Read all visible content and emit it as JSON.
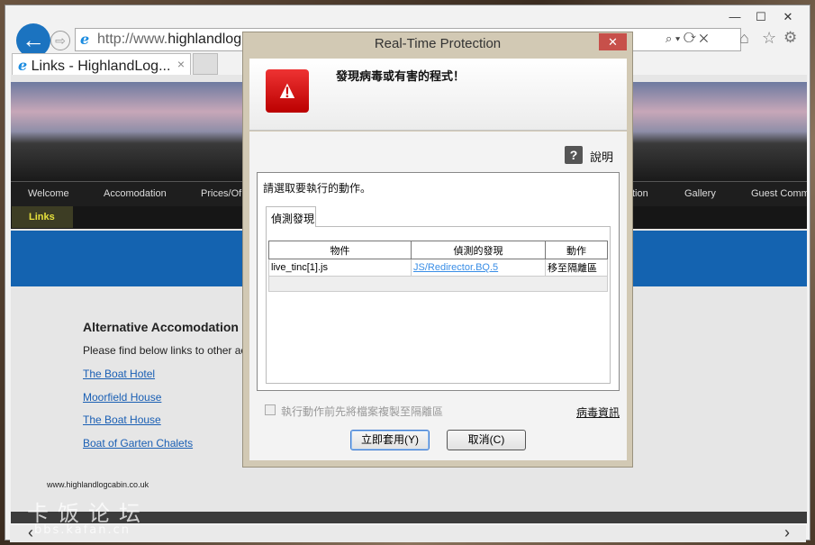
{
  "browser": {
    "url_prefix": "http://www.",
    "url_host": "highlandlog",
    "tab_title": "Links - HighlandLog...",
    "tab_close": "×",
    "minimize": "—",
    "maximize": "☐",
    "close": "✕",
    "back": "←",
    "forward": "⇨",
    "right_icons": "⌕ ▾ ⟳ ✕",
    "home": "⌂",
    "favorites": "☆",
    "settings": "⚙"
  },
  "site": {
    "menu": [
      "Welcome",
      "Accomodation",
      "Prices/Of",
      "tion",
      "Gallery",
      "Guest Comm"
    ],
    "active_menu": "Links",
    "heading": "Alternative Accomodation",
    "intro": "Please find below links to other ac",
    "links": [
      "The Boat Hotel",
      "Moorfield House",
      "The Boat House",
      "Boat of Garten Chalets"
    ],
    "footer": "www.highlandlogcabin.co.uk",
    "scroll_left": "‹",
    "scroll_right": "›"
  },
  "watermark": {
    "line1": "卡饭论坛",
    "line2": "bbs.kafan.cn"
  },
  "dialog": {
    "title": "Real-Time Protection",
    "close": "✕",
    "warning_icon": "!",
    "header": "發現病毒或有害的程式！",
    "help_icon": "?",
    "help": "說明",
    "prompt": "請選取要執行的動作。",
    "tab": "偵測發現",
    "columns": [
      "物件",
      "偵測的發現",
      "動作"
    ],
    "rows": [
      {
        "object": "live_tinc[1].js",
        "detection": "JS/Redirector.BQ.5",
        "action": "移至隔離區"
      }
    ],
    "checkbox_label": "執行動作前先將檔案複製至隔離區",
    "checkbox_checked": false,
    "virus_info": "病毒資訊",
    "apply": "立即套用(Y)",
    "cancel": "取消(C)"
  }
}
